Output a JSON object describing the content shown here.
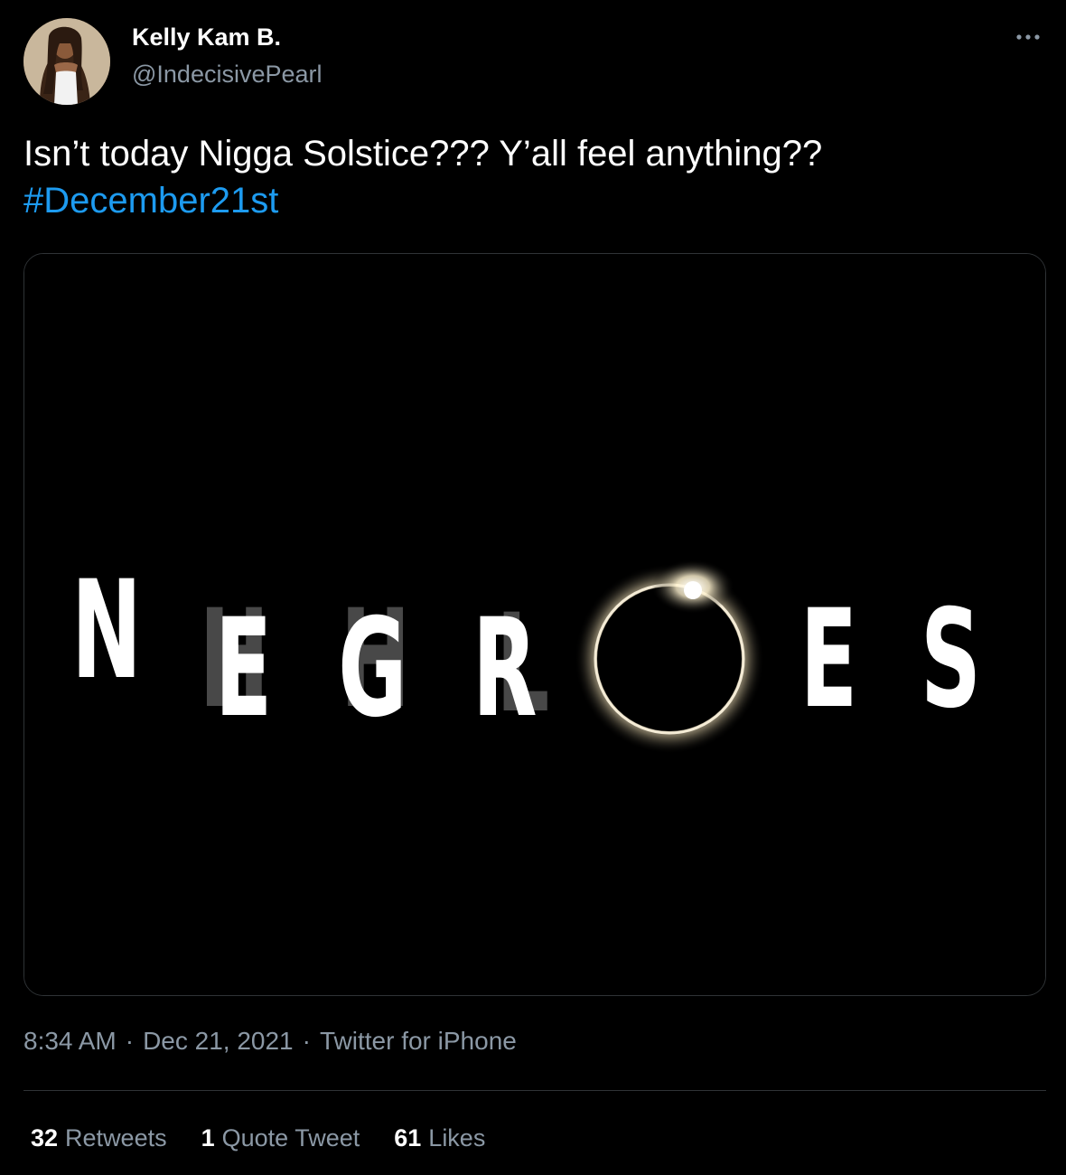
{
  "author": {
    "name": "Kelly Kam B.",
    "handle": "@IndecisivePearl"
  },
  "tweet": {
    "text": "Isn’t today Nigga Solstice??? Y’all feel anything??",
    "hashtag": "#December21st"
  },
  "media": {
    "letters": [
      "N",
      "E",
      "G",
      "R",
      "E",
      "S"
    ],
    "ghost_letters": [
      "H",
      "H",
      "L"
    ]
  },
  "meta": {
    "time": "8:34 AM",
    "separator": "·",
    "date": "Dec 21, 2021",
    "source": "Twitter for iPhone"
  },
  "stats": {
    "retweets": {
      "count": "32",
      "label": "Retweets"
    },
    "quotes": {
      "count": "1",
      "label": "Quote Tweet"
    },
    "likes": {
      "count": "61",
      "label": "Likes"
    }
  },
  "colors": {
    "background": "#000000",
    "link": "#1d9bf0",
    "muted": "#8b98a5",
    "border": "#2f3336"
  }
}
